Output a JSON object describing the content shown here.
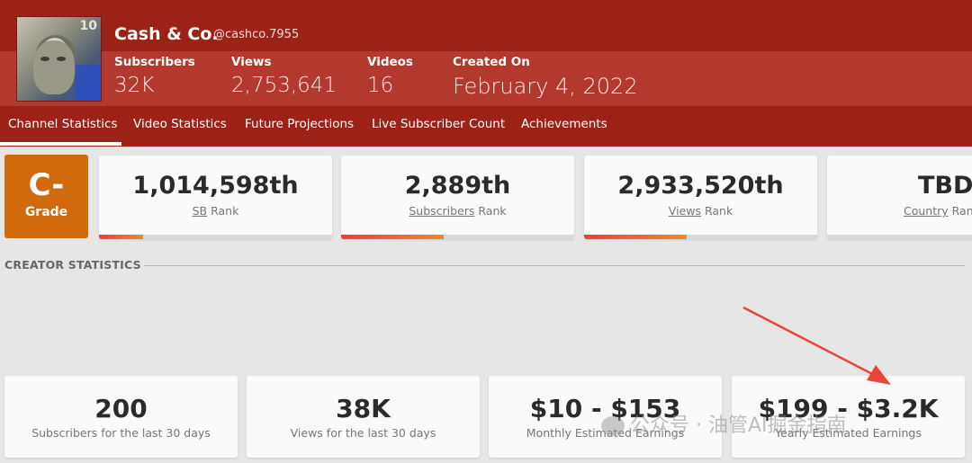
{
  "channel": {
    "name": "Cash & Co.",
    "handle": "@cashco.7955",
    "avatar_digits": "10"
  },
  "header_stats": [
    {
      "label": "Subscribers",
      "value": "32K"
    },
    {
      "label": "Views",
      "value": "2,753,641"
    },
    {
      "label": "Videos",
      "value": "16"
    },
    {
      "label": "Created On",
      "value": "February 4, 2022"
    }
  ],
  "nav": {
    "active": "Channel Statistics",
    "items": [
      "Channel Statistics",
      "Video Statistics",
      "Future Projections",
      "Live Subscriber Count",
      "Achievements"
    ]
  },
  "grade": {
    "value": "C-",
    "label": "Grade"
  },
  "ranks": [
    {
      "value": "1,014,598th",
      "link": "SB",
      "suffix": " Rank",
      "progress": 0.19
    },
    {
      "value": "2,889th",
      "link": "Subscribers",
      "suffix": " Rank",
      "progress": 0.44
    },
    {
      "value": "2,933,520th",
      "link": "Views",
      "suffix": " Rank",
      "progress": 0.44
    },
    {
      "value": "TBD",
      "link": "Country",
      "suffix": " Rank",
      "progress": 0
    }
  ],
  "creator_statistics": {
    "title": "CREATOR STATISTICS",
    "cards": [
      {
        "value": "200",
        "label": "Subscribers for the last 30 days"
      },
      {
        "value": "38K",
        "label": "Views for the last 30 days"
      },
      {
        "value": "$10 - $153",
        "label": "Monthly Estimated Earnings"
      },
      {
        "value": "$199 - $3.2K",
        "label": "Yearly Estimated Earnings"
      }
    ]
  },
  "annotation": {
    "arrow_color": "#e8453c"
  },
  "watermark": {
    "text": "公众号 · 油管AI掘金指南"
  },
  "colors": {
    "header_dark": "#9c2218",
    "header_mid": "#b3392f",
    "grade_bg": "#d06a0c",
    "rank_bar_start": "#e6423a",
    "rank_bar_end": "#f08a24"
  }
}
